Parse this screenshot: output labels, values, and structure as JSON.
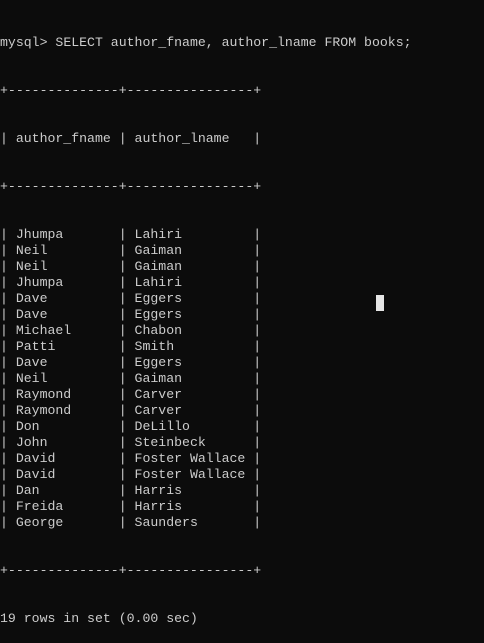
{
  "terminal": {
    "prompt": "mysql> ",
    "command": "SELECT author_fname, author_lname FROM books;",
    "border": "+--------------+----------------+",
    "table": {
      "headers": [
        "author_fname",
        "author_lname"
      ],
      "rows": [
        [
          "Jhumpa",
          "Lahiri"
        ],
        [
          "Neil",
          "Gaiman"
        ],
        [
          "Neil",
          "Gaiman"
        ],
        [
          "Jhumpa",
          "Lahiri"
        ],
        [
          "Dave",
          "Eggers"
        ],
        [
          "Dave",
          "Eggers"
        ],
        [
          "Michael",
          "Chabon"
        ],
        [
          "Patti",
          "Smith"
        ],
        [
          "Dave",
          "Eggers"
        ],
        [
          "Neil",
          "Gaiman"
        ],
        [
          "Raymond",
          "Carver"
        ],
        [
          "Raymond",
          "Carver"
        ],
        [
          "Don",
          "DeLillo"
        ],
        [
          "John",
          "Steinbeck"
        ],
        [
          "David",
          "Foster Wallace"
        ],
        [
          "David",
          "Foster Wallace"
        ],
        [
          "Dan",
          "Harris"
        ],
        [
          "Freida",
          "Harris"
        ],
        [
          "George",
          "Saunders"
        ]
      ]
    },
    "status": "19 rows in set (0.00 sec)"
  },
  "colors": {
    "background": "#0c0c0c",
    "text": "#cccccc",
    "cursor": "#e6e6e6"
  }
}
